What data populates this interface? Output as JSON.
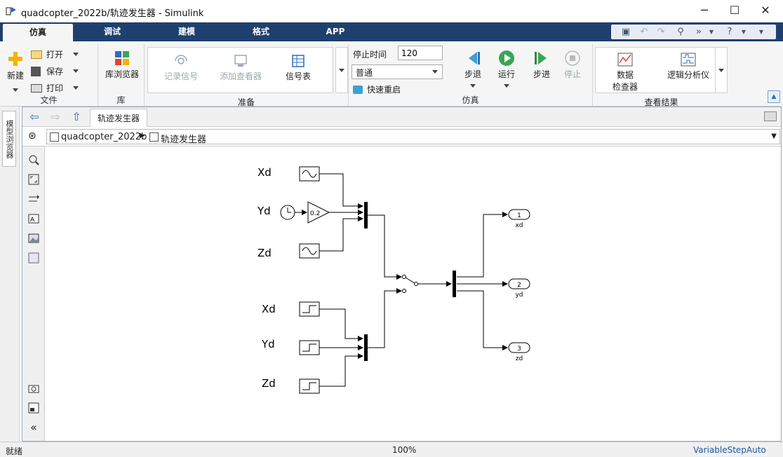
{
  "window": {
    "title": "quadcopter_2022b/轨迹发生器 - Simulink"
  },
  "tabs": [
    "仿真",
    "调试",
    "建模",
    "格式",
    "APP"
  ],
  "ribbon": {
    "file": {
      "new": "新建",
      "open": "打开",
      "save": "保存",
      "print": "打印",
      "label": "文件"
    },
    "library": {
      "browser": "库浏览器",
      "label": "库"
    },
    "prepare": {
      "log_signals": "记录信号",
      "add_viewer": "添加查看器",
      "signal_table": "信号表",
      "label": "准备"
    },
    "simulate": {
      "stop_time_label": "停止时间",
      "stop_time_value": "120",
      "mode": "普通",
      "fast_restart": "快速重启",
      "step_back": "步退",
      "run": "运行",
      "step_forward": "步进",
      "stop": "停止",
      "label": "仿真"
    },
    "review": {
      "data_inspector_1": "数据",
      "data_inspector_2": "检查器",
      "logic_analyzer": "逻辑分析仪",
      "label": "查看结果"
    }
  },
  "sidebar": {
    "model_browser": "模型浏览器"
  },
  "editor": {
    "tab": "轨迹发生器",
    "breadcrumb": [
      "quadcopter_2022b",
      "轨迹发生器"
    ]
  },
  "diagram": {
    "labels": [
      "Xd",
      "Yd",
      "Zd",
      "Xd",
      "Yd",
      "Zd"
    ],
    "gain": "0.2",
    "outports": [
      {
        "num": "1",
        "name": "xd"
      },
      {
        "num": "2",
        "name": "yd"
      },
      {
        "num": "3",
        "name": "zd"
      }
    ]
  },
  "status": {
    "state": "就绪",
    "zoom": "100%",
    "solver": "VariableStepAuto"
  },
  "colors": {
    "tabbar": "#1f3f6e",
    "accent": "#1a5aa6"
  }
}
